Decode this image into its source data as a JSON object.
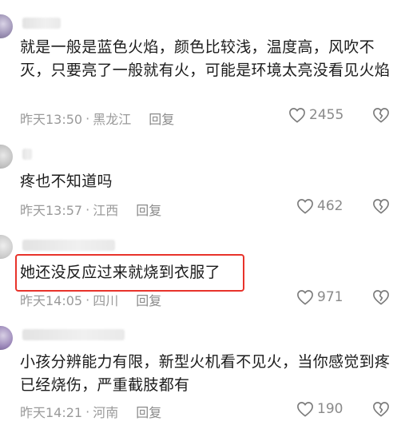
{
  "comments": [
    {
      "text": "就是一般是蓝色火焰，颜色比较浅，温度高，风吹不灭，只要亮了一般就有火，可能是环境太亮没看见火焰",
      "time": "昨天13:50",
      "location": "黑龙江",
      "reply_label": "回复",
      "likes": "2455"
    },
    {
      "text": "疼也不知道吗",
      "time": "昨天13:57",
      "location": "江西",
      "reply_label": "回复",
      "likes": "462"
    },
    {
      "text": "她还没反应过来就烧到衣服了",
      "time": "昨天14:05",
      "location": "四川",
      "reply_label": "回复",
      "likes": "971"
    },
    {
      "text": "小孩分辨能力有限，新型火机看不见火，当你感觉到疼已经烧伤，严重截肢都有",
      "time": "昨天14:21",
      "location": "河南",
      "reply_label": "回复",
      "likes": "190"
    }
  ],
  "meta_separator": "·",
  "icons": {
    "like": "heart-outline-icon",
    "dislike": "broken-heart-icon"
  },
  "colors": {
    "highlight": "#e8332b",
    "meta": "#9a9a9a"
  }
}
